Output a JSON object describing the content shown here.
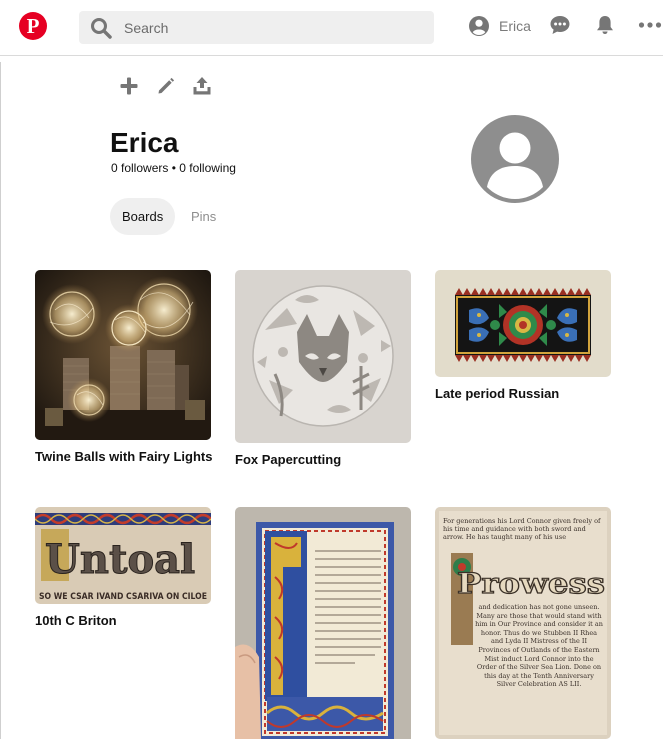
{
  "header": {
    "logo_letter": "P",
    "search": {
      "placeholder": "Search",
      "value": ""
    },
    "user_name": "Erica",
    "icons": [
      "pinterest-logo",
      "search-icon",
      "user-icon",
      "chat-icon",
      "bell-icon",
      "more-icon"
    ]
  },
  "toolbar": {
    "icons": [
      "plus-icon",
      "pencil-icon",
      "share-icon"
    ]
  },
  "profile": {
    "name": "Erica",
    "stats": "0 followers • 0 following"
  },
  "tabs": [
    {
      "label": "Boards",
      "active": true
    },
    {
      "label": "Pins",
      "active": false
    }
  ],
  "boards": [
    {
      "title": "Twine Balls with Fairy Lights"
    },
    {
      "title": "Fox Papercutting"
    },
    {
      "title": "Late period Russian"
    },
    {
      "title": "10th C Briton"
    },
    {
      "title": ""
    },
    {
      "title": ""
    }
  ],
  "artwork_text": {
    "briton_banner": "Untoal",
    "briton_caption": "SO WE CSAR IVAND CSARIVA ON CILOE",
    "prowess_heading": "Prowess",
    "prowess_text_top": "For generations his Lord Connor given freely of his time and guidance with both sword and arrow. He has taught many of his use",
    "prowess_text_bottom": "and dedication has not gone unseen. Many are those that would stand with him in Our Province and consider it an honor. Thus do we Stubben II Rhea and Lyda II Mistress of the II Provinces of Outlands of the Eastern Mist induct Lord Connor into the Order of the Silver Sea Lion. Done on this day at the Tenth Anniversary Silver Celebration AS LII."
  },
  "colors": {
    "brand": "#e60023",
    "tab_active_bg": "#efefef",
    "muted": "#8e8e8e"
  }
}
